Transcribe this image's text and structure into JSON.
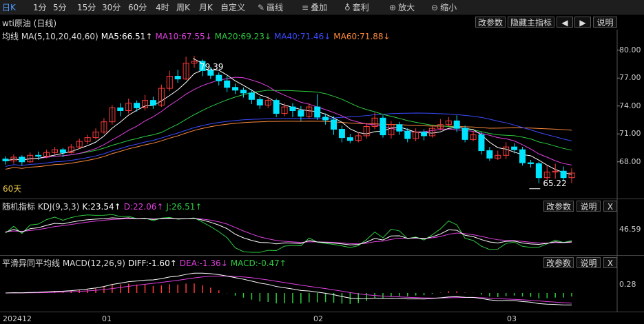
{
  "toolbar": {
    "periods": [
      {
        "label": "日K",
        "active": true
      },
      {
        "label": "1分"
      },
      {
        "label": "5分"
      },
      {
        "label": "15分"
      },
      {
        "label": "30分"
      },
      {
        "label": "60分"
      },
      {
        "label": "4时"
      },
      {
        "label": "周K"
      },
      {
        "label": "月K"
      },
      {
        "label": "自定义"
      }
    ],
    "tools": [
      {
        "label": "画线",
        "icon": "pencil-icon",
        "glyph": "✎"
      },
      {
        "label": "叠加",
        "icon": "stack-icon",
        "glyph": "≡"
      },
      {
        "label": "套利",
        "icon": "moneybag-icon",
        "glyph": "♁"
      },
      {
        "label": "放大",
        "icon": "zoom-in-icon",
        "glyph": "⊕"
      },
      {
        "label": "缩小",
        "icon": "zoom-out-icon",
        "glyph": "⊖"
      }
    ]
  },
  "main": {
    "title": "wti原油 (日线)",
    "buttons": {
      "params": "改参数",
      "hide": "隐藏主指标",
      "left": "◀",
      "right": "▶",
      "help": "说明"
    },
    "ma_legend": [
      {
        "text": "均线 MA(5,10,20,40,60)",
        "color": "#dddddd"
      },
      {
        "text": "MA5:66.51↑",
        "color": "#ffffff"
      },
      {
        "text": "MA10:67.55↓",
        "color": "#e040e0"
      },
      {
        "text": "MA20:69.23↓",
        "color": "#2ecc40"
      },
      {
        "text": "MA40:71.46↓",
        "color": "#3b4bff"
      },
      {
        "text": "MA60:71.88↓",
        "color": "#ff8a3d"
      }
    ],
    "high_label": "79.39",
    "low_label": "65.22",
    "period_label": "60天",
    "y_ticks": [
      "80.00",
      "77.00",
      "74.00",
      "71.00",
      "68.00"
    ]
  },
  "kdj": {
    "legend": [
      {
        "text": "随机指标 KDJ(9,3,3)",
        "color": "#dddddd"
      },
      {
        "text": "K:23.54↑",
        "color": "#ffffff"
      },
      {
        "text": "D:22.06↑",
        "color": "#e040e0"
      },
      {
        "text": "J:26.51↑",
        "color": "#2ecc40"
      }
    ],
    "buttons": {
      "params": "改参数",
      "help": "说明",
      "close": "X"
    },
    "y_tick": "46.59"
  },
  "macd": {
    "legend": [
      {
        "text": "平滑异同平均线 MACD(12,26,9)",
        "color": "#dddddd"
      },
      {
        "text": "DIFF:-1.60↑",
        "color": "#ffffff"
      },
      {
        "text": "DEA:-1.36↓",
        "color": "#e040e0"
      },
      {
        "text": "MACD:-0.47↑",
        "color": "#2ecc40"
      }
    ],
    "buttons": {
      "params": "改参数",
      "help": "说明",
      "close": "X"
    },
    "y_tick": "0.28"
  },
  "x_labels": [
    "202412",
    "01",
    "02",
    "03"
  ],
  "colors": {
    "up": "#ff3b3b",
    "down": "#00e5ff",
    "ma5": "#ffffff",
    "ma10": "#e040e0",
    "ma20": "#2ecc40",
    "ma40": "#3b4bff",
    "ma60": "#ff8a3d"
  },
  "chart_data": {
    "type": "candlestick",
    "title": "wti原油 (日线)",
    "ylim": [
      64.5,
      80.5
    ],
    "x_start": "2024-12-05",
    "candles": [
      [
        68.3,
        68.1,
        68.6,
        67.7
      ],
      [
        68.1,
        68.5,
        68.8,
        67.8
      ],
      [
        68.5,
        68.0,
        68.7,
        67.6
      ],
      [
        68.0,
        68.7,
        69.0,
        67.9
      ],
      [
        68.7,
        68.6,
        69.1,
        68.2
      ],
      [
        68.6,
        69.0,
        69.3,
        68.4
      ],
      [
        69.0,
        69.3,
        69.6,
        68.8
      ],
      [
        69.3,
        69.0,
        69.5,
        68.5
      ],
      [
        69.0,
        69.6,
        69.9,
        68.9
      ],
      [
        69.6,
        70.2,
        70.5,
        69.4
      ],
      [
        70.2,
        70.6,
        70.9,
        69.9
      ],
      [
        70.6,
        71.2,
        71.6,
        70.4
      ],
      [
        71.2,
        72.3,
        72.7,
        71.0
      ],
      [
        72.3,
        73.8,
        74.1,
        72.0
      ],
      [
        73.8,
        73.5,
        74.3,
        72.9
      ],
      [
        73.5,
        74.3,
        74.8,
        73.2
      ],
      [
        74.3,
        73.8,
        74.6,
        73.4
      ],
      [
        73.8,
        74.6,
        75.2,
        73.5
      ],
      [
        74.6,
        74.1,
        75.0,
        73.7
      ],
      [
        74.1,
        75.9,
        76.3,
        73.9
      ],
      [
        75.9,
        77.2,
        77.8,
        75.6
      ],
      [
        77.2,
        76.9,
        77.9,
        76.5
      ],
      [
        76.9,
        78.6,
        79.3,
        76.8
      ],
      [
        78.6,
        78.8,
        79.4,
        78.1
      ],
      [
        78.8,
        77.8,
        79.0,
        77.2
      ],
      [
        77.8,
        77.3,
        78.2,
        76.9
      ],
      [
        77.3,
        76.7,
        77.6,
        76.2
      ],
      [
        76.7,
        76.0,
        77.2,
        75.5
      ],
      [
        76.0,
        75.7,
        76.4,
        75.3
      ],
      [
        75.7,
        75.4,
        76.0,
        74.9
      ],
      [
        75.4,
        74.7,
        75.8,
        74.2
      ],
      [
        74.7,
        74.1,
        75.0,
        73.7
      ],
      [
        74.1,
        74.6,
        75.0,
        73.8
      ],
      [
        74.6,
        73.2,
        74.8,
        72.8
      ],
      [
        73.2,
        73.9,
        74.3,
        72.9
      ],
      [
        73.9,
        73.5,
        74.3,
        72.8
      ],
      [
        73.5,
        72.9,
        74.0,
        72.4
      ],
      [
        72.9,
        73.9,
        74.3,
        72.6
      ],
      [
        73.9,
        72.8,
        75.3,
        72.5
      ],
      [
        72.8,
        72.5,
        73.2,
        72.0
      ],
      [
        72.5,
        71.5,
        72.9,
        70.9
      ],
      [
        71.5,
        70.6,
        71.9,
        70.1
      ],
      [
        70.6,
        70.3,
        71.0,
        70.0
      ],
      [
        70.3,
        70.8,
        71.2,
        70.1
      ],
      [
        70.8,
        71.8,
        72.2,
        70.5
      ],
      [
        71.8,
        72.7,
        73.3,
        71.5
      ],
      [
        72.7,
        70.9,
        73.0,
        70.6
      ],
      [
        70.9,
        72.0,
        72.4,
        70.5
      ],
      [
        72.0,
        71.3,
        72.3,
        70.9
      ],
      [
        71.3,
        70.5,
        71.6,
        70.1
      ],
      [
        70.5,
        71.2,
        71.6,
        70.2
      ],
      [
        71.2,
        70.8,
        71.5,
        70.3
      ],
      [
        70.8,
        71.6,
        72.0,
        70.6
      ],
      [
        71.6,
        72.0,
        72.6,
        71.4
      ],
      [
        72.0,
        72.4,
        72.8,
        71.8
      ],
      [
        72.4,
        71.6,
        73.0,
        71.2
      ],
      [
        71.6,
        70.4,
        71.9,
        70.1
      ],
      [
        70.4,
        70.9,
        71.3,
        70.2
      ],
      [
        70.9,
        69.2,
        71.2,
        68.8
      ],
      [
        69.2,
        68.4,
        69.6,
        68.1
      ],
      [
        68.4,
        68.7,
        69.2,
        68.2
      ],
      [
        68.7,
        69.6,
        70.1,
        68.3
      ],
      [
        69.6,
        69.3,
        70.0,
        68.9
      ],
      [
        69.3,
        67.9,
        69.6,
        67.6
      ],
      [
        67.9,
        67.8,
        68.2,
        67.4
      ],
      [
        67.8,
        66.3,
        68.0,
        65.7
      ],
      [
        66.3,
        66.9,
        67.6,
        66.0
      ],
      [
        66.9,
        67.0,
        67.8,
        66.2
      ],
      [
        67.0,
        66.3,
        67.5,
        65.9
      ],
      [
        66.3,
        66.8,
        67.3,
        65.7
      ]
    ]
  }
}
